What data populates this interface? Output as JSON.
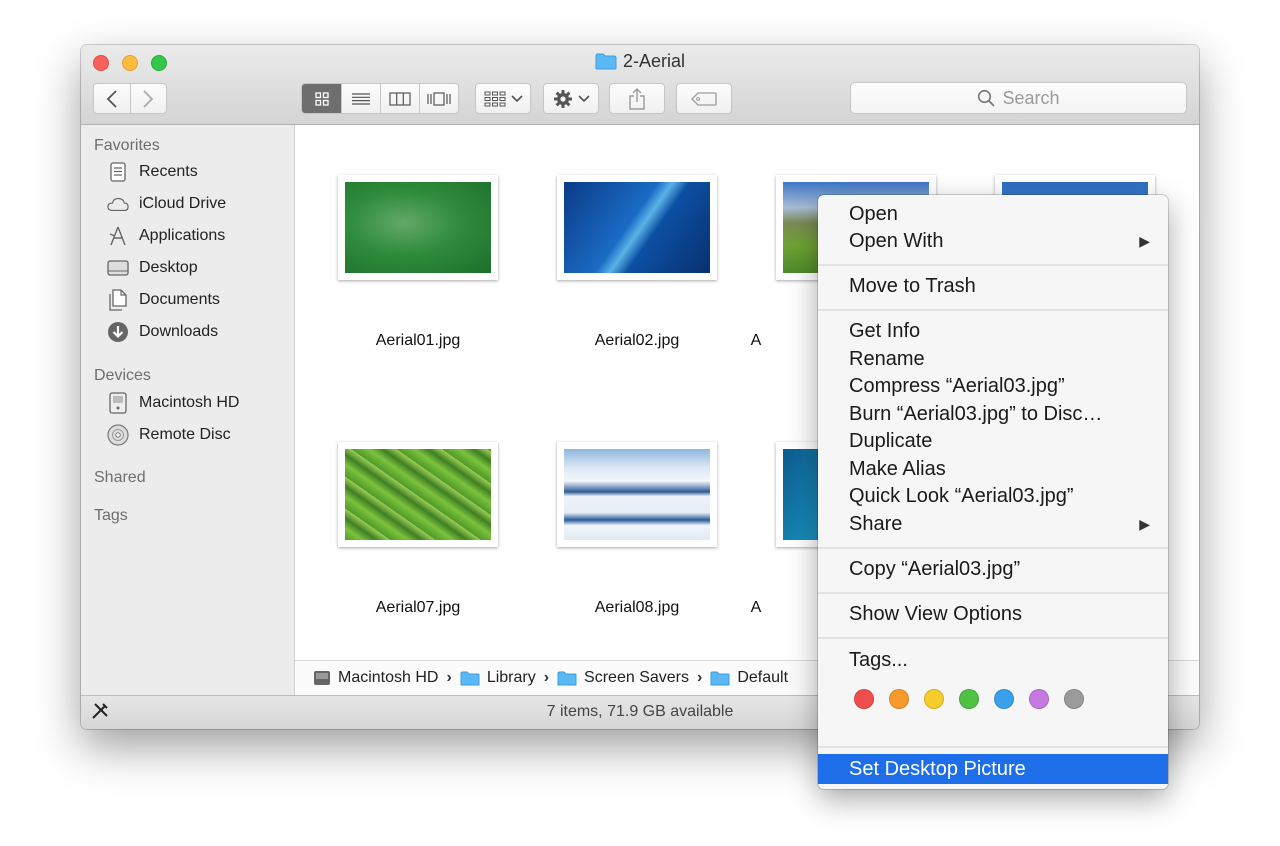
{
  "window": {
    "title": "2-Aerial"
  },
  "toolbar": {
    "view_modes": [
      "icon-view",
      "list-view",
      "column-view",
      "cover-flow-view"
    ],
    "active_view": "icon-view",
    "search_placeholder": "Search"
  },
  "sidebar": {
    "favorites_label": "Favorites",
    "favorites": [
      {
        "label": "Recents",
        "icon": "recents-icon"
      },
      {
        "label": "iCloud Drive",
        "icon": "cloud-icon"
      },
      {
        "label": "Applications",
        "icon": "applications-icon"
      },
      {
        "label": "Desktop",
        "icon": "desktop-icon"
      },
      {
        "label": "Documents",
        "icon": "documents-icon"
      },
      {
        "label": "Downloads",
        "icon": "downloads-icon"
      }
    ],
    "devices_label": "Devices",
    "devices": [
      {
        "label": "Macintosh HD",
        "icon": "hard-drive-icon"
      },
      {
        "label": "Remote Disc",
        "icon": "disc-icon"
      }
    ],
    "shared_label": "Shared",
    "tags_label": "Tags"
  },
  "files": [
    {
      "name": "Aerial01.jpg"
    },
    {
      "name": "Aerial02.jpg"
    },
    {
      "name": "A"
    },
    {
      "name": ""
    },
    {
      "name": "Aerial07.jpg"
    },
    {
      "name": "Aerial08.jpg"
    },
    {
      "name": "A"
    }
  ],
  "pathbar": {
    "segments": [
      "Macintosh HD",
      "Library",
      "Screen Savers",
      "Default"
    ]
  },
  "statusbar": {
    "text": "7 items, 71.9 GB available"
  },
  "context_menu": {
    "open": "Open",
    "open_with": "Open With",
    "move_to_trash": "Move to Trash",
    "get_info": "Get Info",
    "rename": "Rename",
    "compress": "Compress “Aerial03.jpg”",
    "burn": "Burn “Aerial03.jpg” to Disc…",
    "duplicate": "Duplicate",
    "make_alias": "Make Alias",
    "quick_look": "Quick Look “Aerial03.jpg”",
    "share": "Share",
    "copy": "Copy “Aerial03.jpg”",
    "show_view_options": "Show View Options",
    "tags": "Tags...",
    "tag_colors": [
      "#f24d4d",
      "#f8992c",
      "#f5cc2a",
      "#4fc143",
      "#3aa0ec",
      "#c47ae0",
      "#9b9b9b"
    ],
    "set_desktop_picture": "Set Desktop Picture"
  },
  "colors": {
    "selection": "#1d6ee8",
    "folder": "#5ab8f5"
  }
}
